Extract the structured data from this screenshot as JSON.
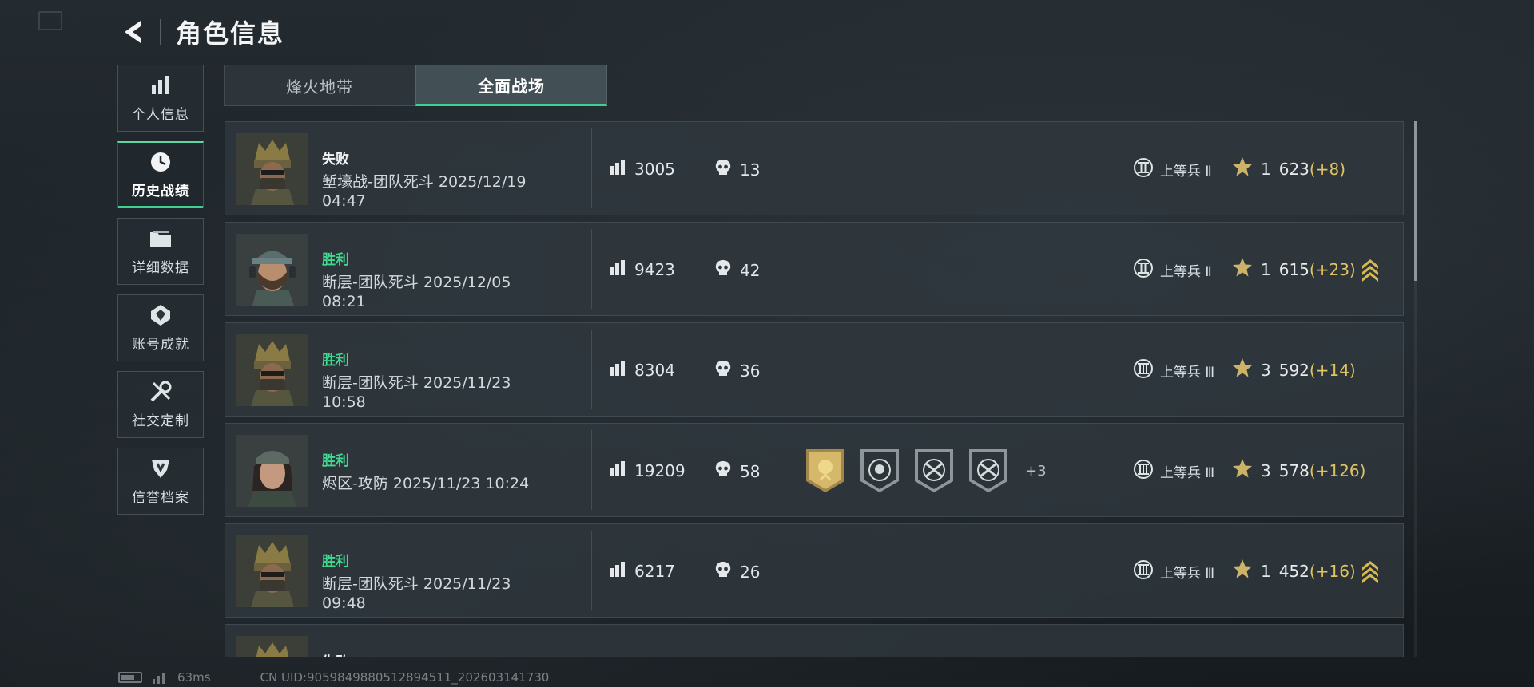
{
  "header": {
    "title": "角色信息"
  },
  "sidebar": {
    "items": [
      {
        "label": "个人信息",
        "icon": "bar-chart-icon",
        "active": false
      },
      {
        "label": "历史战绩",
        "icon": "clock-icon",
        "active": true
      },
      {
        "label": "详细数据",
        "icon": "folder-icon",
        "active": false
      },
      {
        "label": "账号成就",
        "icon": "achievement-badge-icon",
        "active": false
      },
      {
        "label": "社交定制",
        "icon": "tools-icon",
        "active": false
      },
      {
        "label": "信誉档案",
        "icon": "shield-icon",
        "active": false
      }
    ]
  },
  "tabs": [
    {
      "label": "烽火地带",
      "active": false
    },
    {
      "label": "全面战场",
      "active": true
    }
  ],
  "matches": [
    {
      "result": "失败",
      "win": false,
      "mode": "堑壕战-团队死斗 2025/12/19 04:47",
      "score": "3005",
      "kills": "13",
      "medals": [],
      "medals_more": "",
      "rank": "上等兵 Ⅱ",
      "rank_icon": "II",
      "stars": "1",
      "points": "623",
      "delta": "(+8)",
      "promotion": false,
      "avatar": "helmet-soldier"
    },
    {
      "result": "胜利",
      "win": true,
      "mode": "断层-团队死斗 2025/12/05 08:21",
      "score": "9423",
      "kills": "42",
      "medals": [],
      "medals_more": "",
      "rank": "上等兵 Ⅱ",
      "rank_icon": "II",
      "stars": "1",
      "points": "615",
      "delta": "(+23)",
      "promotion": true,
      "avatar": "headset-soldier"
    },
    {
      "result": "胜利",
      "win": true,
      "mode": "断层-团队死斗 2025/11/23 10:58",
      "score": "8304",
      "kills": "36",
      "medals": [],
      "medals_more": "",
      "rank": "上等兵 Ⅲ",
      "rank_icon": "III",
      "stars": "3",
      "points": "592",
      "delta": "(+14)",
      "promotion": false,
      "avatar": "helmet-soldier"
    },
    {
      "result": "胜利",
      "win": true,
      "mode": "烬区-攻防 2025/11/23 10:24",
      "score": "19209",
      "kills": "58",
      "medals": [
        "gold-emblem",
        "skull-target",
        "crossed-rifles",
        "crossed-rifles"
      ],
      "medals_more": "+3",
      "rank": "上等兵 Ⅲ",
      "rank_icon": "III",
      "stars": "3",
      "points": "578",
      "delta": "(+126)",
      "promotion": false,
      "avatar": "female-operator"
    },
    {
      "result": "胜利",
      "win": true,
      "mode": "断层-团队死斗 2025/11/23 09:48",
      "score": "6217",
      "kills": "26",
      "medals": [],
      "medals_more": "",
      "rank": "上等兵 Ⅲ",
      "rank_icon": "III",
      "stars": "1",
      "points": "452",
      "delta": "(+16)",
      "promotion": true,
      "avatar": "helmet-soldier"
    },
    {
      "result": "失败",
      "win": false,
      "mode": "",
      "score": "",
      "kills": "",
      "medals": [],
      "medals_more": "",
      "rank": "",
      "rank_icon": "",
      "stars": "",
      "points": "",
      "delta": "",
      "promotion": false,
      "avatar": "helmet-soldier"
    }
  ],
  "footer": {
    "ping": "63ms",
    "uid": "CN UID:9059849880512894511_202603141730"
  },
  "colors": {
    "accent": "#3fd18f",
    "win": "#3fd98f",
    "delta": "#e0c463"
  }
}
